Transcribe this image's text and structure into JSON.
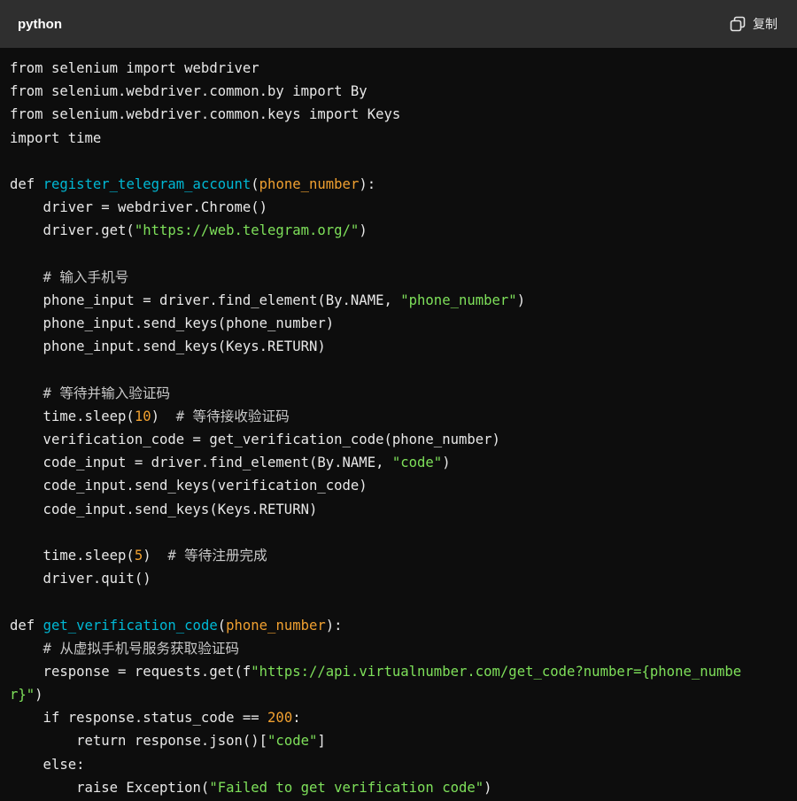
{
  "header": {
    "language": "python",
    "copy_label": "复制"
  },
  "code_lines": [
    [
      {
        "t": "from selenium import webdriver"
      }
    ],
    [
      {
        "t": "from selenium.webdriver.common.by import By"
      }
    ],
    [
      {
        "t": "from selenium.webdriver.common.keys import Keys"
      }
    ],
    [
      {
        "t": "import time"
      }
    ],
    [],
    [
      {
        "t": "def "
      },
      {
        "t": "register_telegram_account",
        "c": "fn"
      },
      {
        "t": "("
      },
      {
        "t": "phone_number",
        "c": "param"
      },
      {
        "t": "):"
      }
    ],
    [
      {
        "t": "    driver = webdriver.Chrome()"
      }
    ],
    [
      {
        "t": "    driver.get("
      },
      {
        "t": "\"https://web.telegram.org/\"",
        "c": "str"
      },
      {
        "t": ")"
      }
    ],
    [],
    [
      {
        "t": "    # 输入手机号",
        "c": "com"
      }
    ],
    [
      {
        "t": "    phone_input = driver.find_element(By.NAME, "
      },
      {
        "t": "\"phone_number\"",
        "c": "str"
      },
      {
        "t": ")"
      }
    ],
    [
      {
        "t": "    phone_input.send_keys(phone_number)"
      }
    ],
    [
      {
        "t": "    phone_input.send_keys(Keys.RETURN)"
      }
    ],
    [],
    [
      {
        "t": "    # 等待并输入验证码",
        "c": "com"
      }
    ],
    [
      {
        "t": "    time.sleep("
      },
      {
        "t": "10",
        "c": "num"
      },
      {
        "t": ")  "
      },
      {
        "t": "# 等待接收验证码",
        "c": "com"
      }
    ],
    [
      {
        "t": "    verification_code = get_verification_code(phone_number)"
      }
    ],
    [
      {
        "t": "    code_input = driver.find_element(By.NAME, "
      },
      {
        "t": "\"code\"",
        "c": "str"
      },
      {
        "t": ")"
      }
    ],
    [
      {
        "t": "    code_input.send_keys(verification_code)"
      }
    ],
    [
      {
        "t": "    code_input.send_keys(Keys.RETURN)"
      }
    ],
    [],
    [
      {
        "t": "    time.sleep("
      },
      {
        "t": "5",
        "c": "num"
      },
      {
        "t": ")  "
      },
      {
        "t": "# 等待注册完成",
        "c": "com"
      }
    ],
    [
      {
        "t": "    driver.quit()"
      }
    ],
    [],
    [
      {
        "t": "def "
      },
      {
        "t": "get_verification_code",
        "c": "fn"
      },
      {
        "t": "("
      },
      {
        "t": "phone_number",
        "c": "param"
      },
      {
        "t": "):"
      }
    ],
    [
      {
        "t": "    # 从虚拟手机号服务获取验证码",
        "c": "com"
      }
    ],
    [
      {
        "t": "    response = requests.get(f"
      },
      {
        "t": "\"https://api.virtualnumber.com/get_code?number={phone_numbe",
        "c": "str"
      }
    ],
    [
      {
        "t": "r}\"",
        "c": "str"
      },
      {
        "t": ")"
      }
    ],
    [
      {
        "t": "    if response.status_code == "
      },
      {
        "t": "200",
        "c": "num"
      },
      {
        "t": ":"
      }
    ],
    [
      {
        "t": "        return response.json()["
      },
      {
        "t": "\"code\"",
        "c": "str"
      },
      {
        "t": "]"
      }
    ],
    [
      {
        "t": "    else:"
      }
    ],
    [
      {
        "t": "        raise Exception("
      },
      {
        "t": "\"Failed to get verification code\"",
        "c": "str"
      },
      {
        "t": ")"
      }
    ]
  ],
  "colors": {
    "background": "#0d0d0d",
    "header": "#2f2f2f",
    "function": "#00b8d4",
    "parameter": "#f0a030",
    "string": "#7ee05a"
  },
  "icons": {
    "copy": "copy-icon"
  }
}
